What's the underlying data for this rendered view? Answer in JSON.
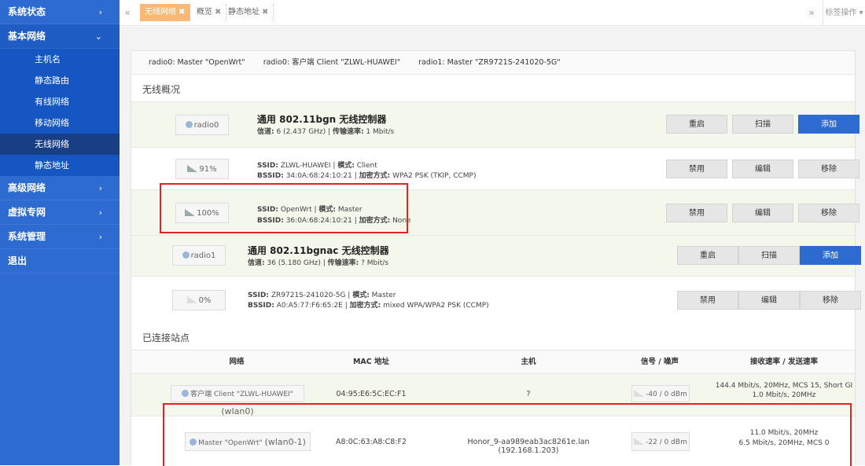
{
  "sidebar": {
    "groups": [
      {
        "label": "系统状态",
        "chevron": "›"
      },
      {
        "label": "基本网络",
        "chevron": "⌄"
      },
      {
        "label": "高级网络",
        "chevron": "›"
      },
      {
        "label": "虚拟专网",
        "chevron": "›"
      },
      {
        "label": "系统管理",
        "chevron": "›"
      },
      {
        "label": "退出",
        "chevron": ""
      }
    ],
    "items": [
      {
        "label": "主机名"
      },
      {
        "label": "静态路由"
      },
      {
        "label": "有线网络"
      },
      {
        "label": "移动网络"
      },
      {
        "label": "无线网络"
      },
      {
        "label": "静态地址"
      }
    ]
  },
  "tabs": {
    "back": "«",
    "forward": "»",
    "items": [
      {
        "label": "无线网络",
        "close": "✖"
      },
      {
        "label": "概览",
        "close": "✖"
      },
      {
        "label": "静态地址",
        "close": "✖"
      }
    ],
    "ops_label": "标签操作 ▾"
  },
  "netline": {
    "items": [
      "radio0: Master \"OpenWrt\"",
      "radio0: 客户端 Client \"ZLWL-HUAWEI\"",
      "radio1: Master \"ZR9721S-241020-5G\""
    ]
  },
  "wireless": {
    "title": "无线概况",
    "buttons": {
      "restart": "重启",
      "scan": "扫描",
      "add": "添加",
      "disable": "禁用",
      "edit": "编辑",
      "remove": "移除"
    },
    "radio0": {
      "badge": "radio0",
      "title": "通用 802.11bgn 无线控制器",
      "channel_label": "信道:",
      "channel_value": " 6 (2.437 GHz) | ",
      "rate_label": "传输速率:",
      "rate_value": " 1 Mbit/s",
      "networks": [
        {
          "badge": "91%",
          "ssid_label": "SSID:",
          "ssid_value": " ZLWL-HUAWEI | ",
          "mode_label": "模式:",
          "mode_value": " Client",
          "bssid_label": "BSSID:",
          "bssid_value": " 34:0A:68:24:10:21 | ",
          "enc_label": "加密方式:",
          "enc_value": " WPA2 PSK (TKIP, CCMP)"
        },
        {
          "badge": "100%",
          "ssid_label": "SSID:",
          "ssid_value": " OpenWrt | ",
          "mode_label": "模式:",
          "mode_value": " Master",
          "bssid_label": "BSSID:",
          "bssid_value": " 36:0A:68:24:10:21 | ",
          "enc_label": "加密方式:",
          "enc_value": " None"
        }
      ]
    },
    "radio1": {
      "badge": "radio1",
      "title": "通用 802.11bgnac 无线控制器",
      "channel_label": "信道:",
      "channel_value": " 36 (5.180 GHz) | ",
      "rate_label": "传输速率:",
      "rate_value": " ? Mbit/s",
      "networks": [
        {
          "badge": "0%",
          "ssid_label": "SSID:",
          "ssid_value": " ZR9721S-241020-5G | ",
          "mode_label": "模式:",
          "mode_value": " Master",
          "bssid_label": "BSSID:",
          "bssid_value": " A0:A5:77:F6:65:2E | ",
          "enc_label": "加密方式:",
          "enc_value": " mixed WPA/WPA2 PSK (CCMP)"
        }
      ]
    }
  },
  "stations": {
    "title": "已连接站点",
    "headers": [
      "网络",
      "MAC 地址",
      "主机",
      "信号 / 噪声",
      "接收速率 / 发送速率"
    ],
    "rows": [
      {
        "network_prefix": "客户端 Client \"ZLWL-HUAWEI\" ",
        "network_iface": "(wlan0)",
        "mac": "04:95:E6:5C:EC:F1",
        "host": "?",
        "signal": "-40 / 0 dBm",
        "rate_rx": "144.4 Mbit/s, 20MHz, MCS 15, Short GI",
        "rate_tx": "1.0 Mbit/s, 20MHz"
      },
      {
        "network_prefix": "Master \"OpenWrt\" ",
        "network_iface": "(wlan0-1)",
        "mac": "A8:0C:63:A8:C8:F2",
        "host": "Honor_9-aa989eab3ac8261e.lan (192.168.1.203)",
        "signal": "-22 / 0 dBm",
        "rate_rx": "11.0 Mbit/s, 20MHz",
        "rate_tx": "6.5 Mbit/s, 20MHz, MCS 0"
      }
    ]
  }
}
